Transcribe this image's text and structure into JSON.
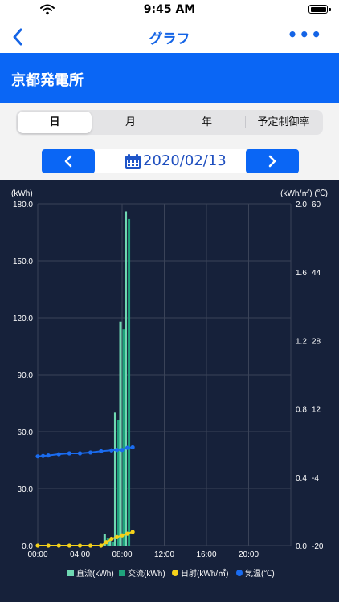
{
  "status": {
    "time": "9:45 AM"
  },
  "nav": {
    "title": "グラフ",
    "more": "•••"
  },
  "plant": {
    "name": "京都発電所"
  },
  "tabs": [
    {
      "label": "日",
      "active": true
    },
    {
      "label": "月",
      "active": false
    },
    {
      "label": "年",
      "active": false
    },
    {
      "label": "予定制御率",
      "active": false
    }
  ],
  "date": {
    "value": "2020/02/13"
  },
  "colors": {
    "accent": "#0a66f5",
    "chart_bg": "#16213a",
    "dc": "#6fd8b2",
    "ac": "#1fa37c",
    "irradiance": "#f5d21a",
    "temperature": "#1a6cf0"
  },
  "chart_data": {
    "type": "bar",
    "left_unit": "(kWh)",
    "right_unit": "(kWh/㎡) (℃)",
    "x_ticks": [
      "00:00",
      "04:00",
      "08:00",
      "12:00",
      "16:00",
      "20:00"
    ],
    "y_ticks_left": [
      "0.0",
      "30.0",
      "60.0",
      "90.0",
      "120.0",
      "150.0",
      "180.0"
    ],
    "y_ticks_right_irradiance": [
      "0.0",
      "0.4",
      "0.8",
      "1.2",
      "1.6",
      "2.0"
    ],
    "y_ticks_right_temperature": [
      "-20",
      "-4",
      "12",
      "28",
      "44",
      "60"
    ],
    "ylim_left": [
      0,
      180
    ],
    "ylim_irradiance": [
      0,
      2.0
    ],
    "ylim_temperature": [
      -20,
      60
    ],
    "x_range_hours": [
      0,
      24
    ],
    "bars": {
      "hours": [
        6.5,
        7,
        7.5,
        8,
        8.5,
        9
      ],
      "dc": [
        6,
        3,
        70,
        118,
        176,
        0
      ],
      "ac": [
        4,
        2,
        66,
        114,
        172,
        0
      ]
    },
    "bar_values": [
      {
        "hour": 6.5,
        "dc": 6,
        "ac": 4
      },
      {
        "hour": 7.0,
        "dc": 3,
        "ac": 2
      },
      {
        "hour": 7.5,
        "dc": 70,
        "ac": 66
      },
      {
        "hour": 8.0,
        "dc": 118,
        "ac": 114
      },
      {
        "hour": 8.5,
        "dc": 176,
        "ac": 172
      }
    ],
    "irradiance": {
      "hours": [
        0,
        1,
        2,
        3,
        4,
        5,
        6,
        6.5,
        7,
        7.5,
        8,
        8.5,
        9
      ],
      "values": [
        0,
        0,
        0,
        0,
        0,
        0,
        0,
        0.02,
        0.04,
        0.05,
        0.06,
        0.07,
        0.08
      ]
    },
    "temperature": {
      "hours": [
        0,
        0.5,
        1,
        2,
        3,
        4,
        5,
        6,
        7,
        7.5,
        8,
        8.5,
        9
      ],
      "values": [
        0.9,
        1.0,
        1.1,
        1.4,
        1.6,
        1.6,
        1.8,
        2.1,
        2.3,
        2.4,
        2.4,
        2.9,
        3.0
      ]
    },
    "legend": [
      "直流(kWh)",
      "交流(kWh)",
      "日射(kWh/㎡)",
      "気温(℃)"
    ]
  }
}
